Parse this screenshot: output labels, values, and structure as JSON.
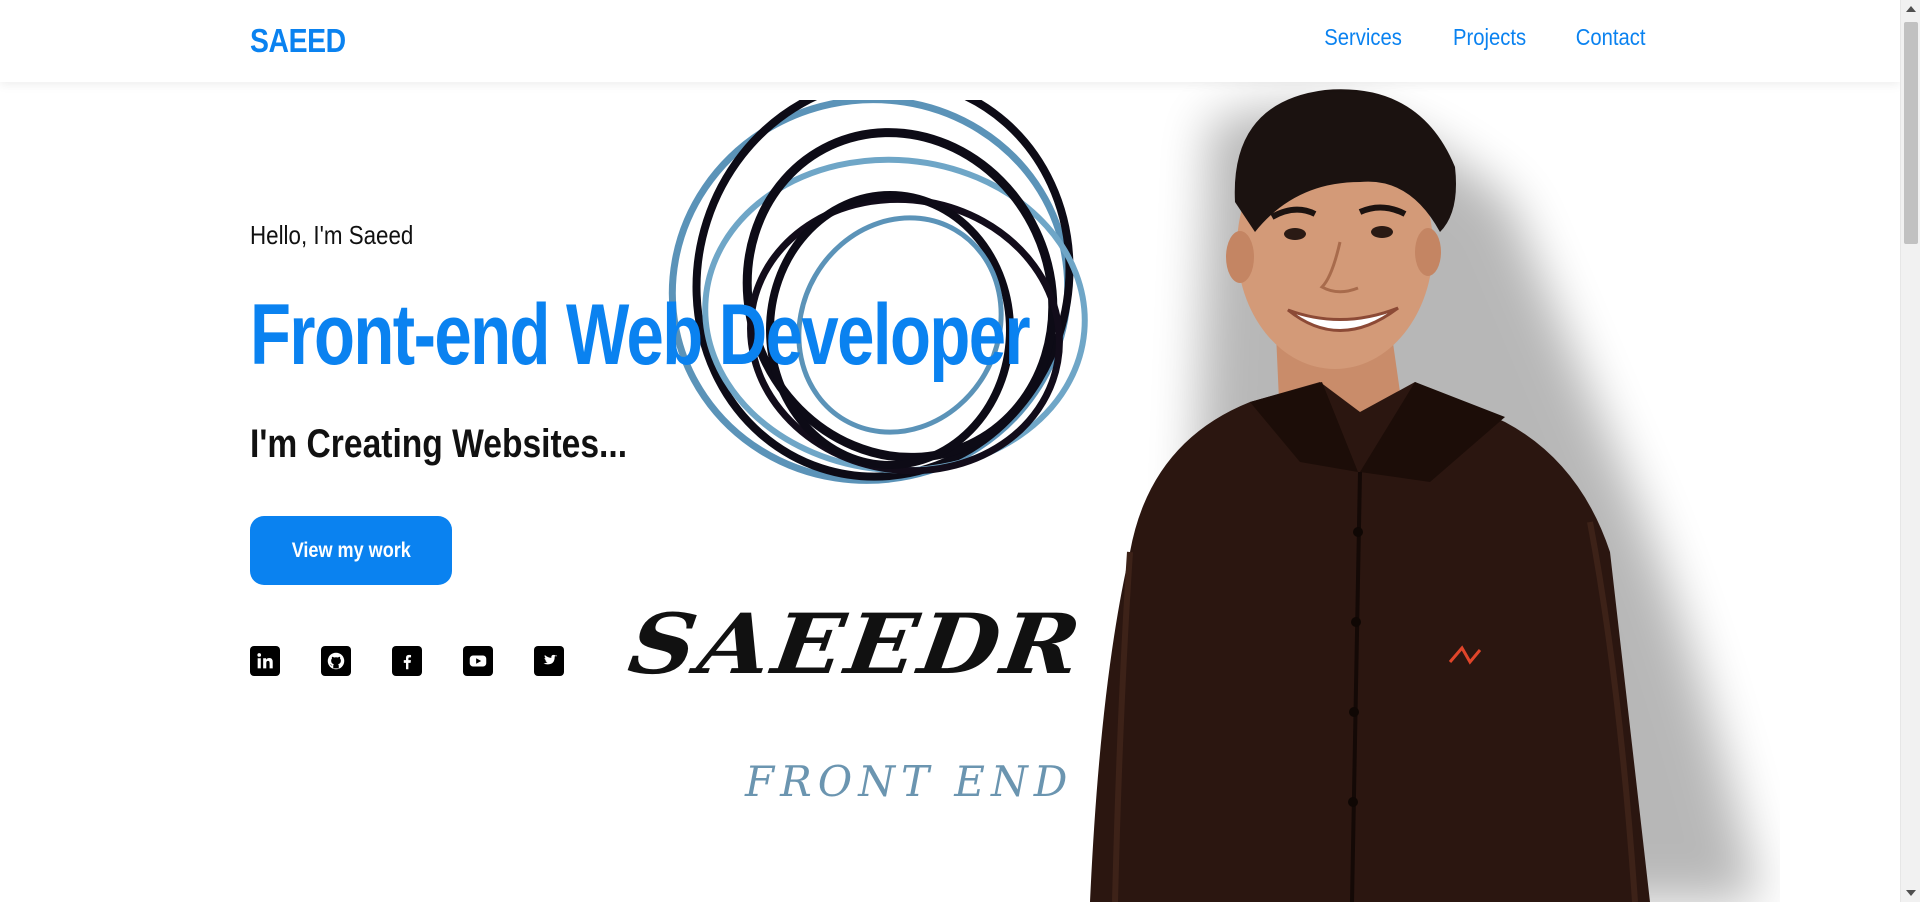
{
  "nav": {
    "brand": "SAEED",
    "links": [
      "Services",
      "Projects",
      "Contact"
    ]
  },
  "hero": {
    "greeting": "Hello, I'm Saeed",
    "headline": "Front-end Web Developer",
    "subheadline": "I'm Creating Websites...",
    "cta_label": "View my work"
  },
  "socials": [
    {
      "name": "linkedin-icon"
    },
    {
      "name": "github-icon"
    },
    {
      "name": "facebook-icon"
    },
    {
      "name": "youtube-icon"
    },
    {
      "name": "twitter-icon"
    }
  ],
  "art": {
    "signature": "SAEEDR",
    "signature_sub": "FRONT END"
  },
  "colors": {
    "accent": "#0a82f0",
    "text": "#111111",
    "shirt": "#2b1610"
  }
}
